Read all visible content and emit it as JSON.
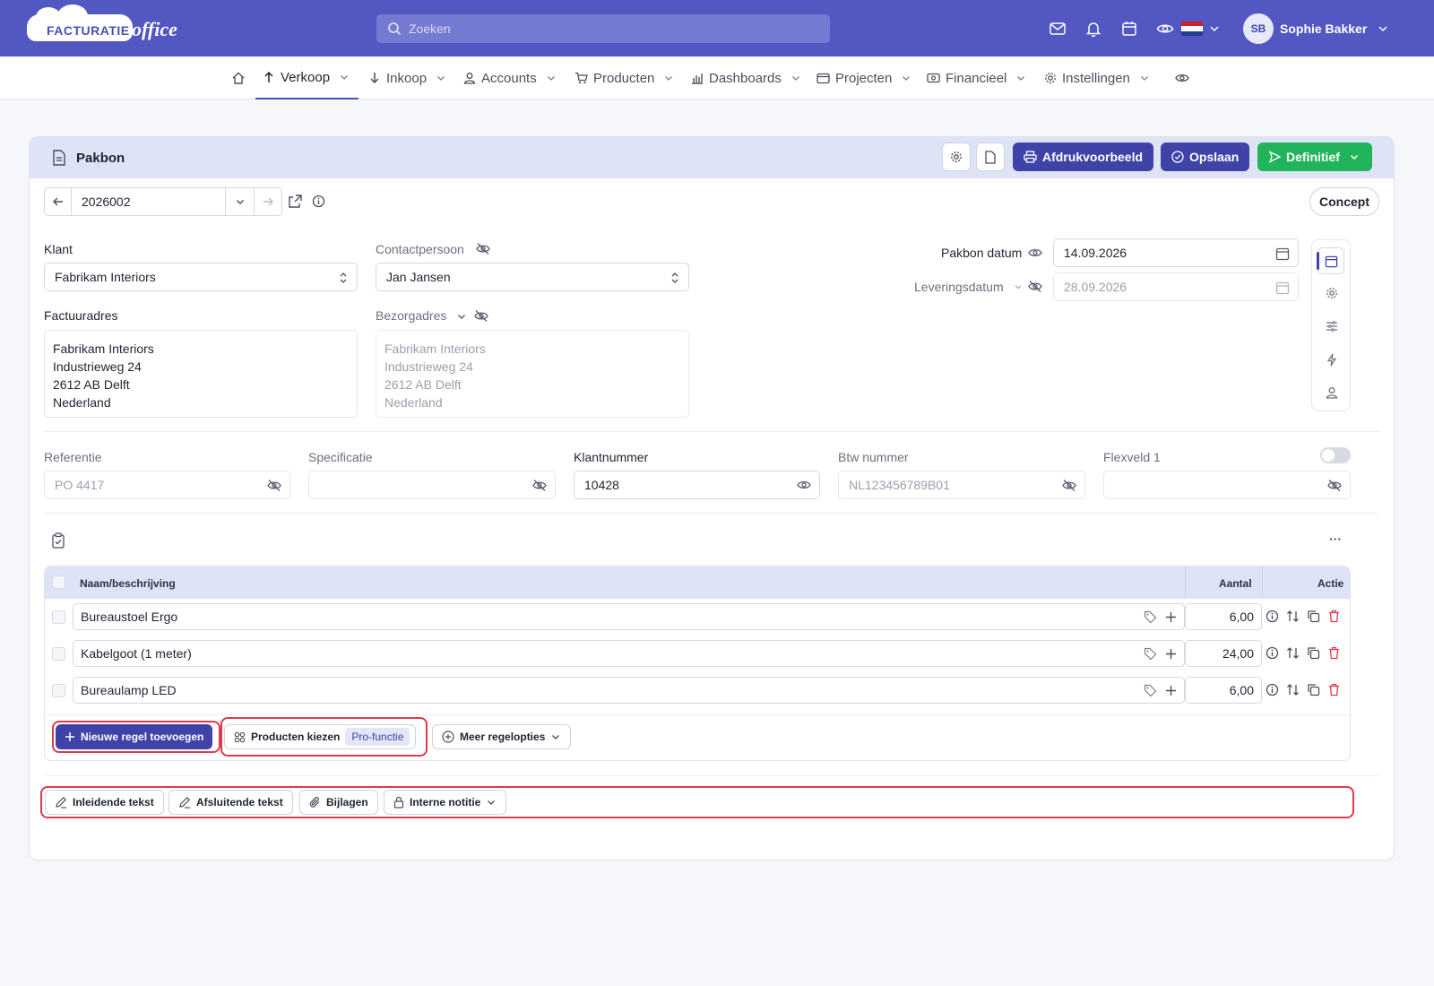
{
  "app": {
    "logo_text_1": "FACTURATIE",
    "logo_text_2": "office"
  },
  "search": {
    "placeholder": "Zoeken"
  },
  "user": {
    "initials": "SB",
    "name": "Sophie Bakker"
  },
  "nav": {
    "items": [
      {
        "label": "Verkoop"
      },
      {
        "label": "Inkoop"
      },
      {
        "label": "Accounts"
      },
      {
        "label": "Producten"
      },
      {
        "label": "Dashboards"
      },
      {
        "label": "Projecten"
      },
      {
        "label": "Financieel"
      },
      {
        "label": "Instellingen"
      }
    ]
  },
  "document": {
    "title": "Pakbon",
    "buttons": {
      "preview": "Afdrukvoorbeeld",
      "save": "Opslaan",
      "final": "Definitief"
    },
    "number": "2026002",
    "status": "Concept"
  },
  "form": {
    "klant_label": "Klant",
    "klant_value": "Fabrikam Interiors",
    "contact_label": "Contactpersoon",
    "contact_value": "Jan Jansen",
    "factuuradres_label": "Factuuradres",
    "factuuradres": [
      "Fabrikam Interiors",
      "Industrieweg 24",
      "2612 AB Delft",
      "Nederland"
    ],
    "bezorgadres_label": "Bezorgadres",
    "bezorgadres": [
      "Fabrikam Interiors",
      "Industrieweg 24",
      "2612 AB Delft",
      "Nederland"
    ],
    "pakbon_datum_label": "Pakbon datum",
    "pakbon_datum": "14.09.2026",
    "leveringsdatum_label": "Leveringsdatum",
    "leveringsdatum": "28.09.2026",
    "referentie_label": "Referentie",
    "referentie": "PO 4417",
    "specificatie_label": "Specificatie",
    "specificatie": "",
    "klantnummer_label": "Klantnummer",
    "klantnummer": "10428",
    "btw_label": "Btw nummer",
    "btw": "NL123456789B01",
    "flexveld_label": "Flexveld 1",
    "flexveld": ""
  },
  "table": {
    "headers": {
      "name": "Naam/beschrijving",
      "qty": "Aantal",
      "action": "Actie"
    },
    "rows": [
      {
        "name": "Bureaustoel Ergo",
        "qty": "6,00"
      },
      {
        "name": "Kabelgoot (1 meter)",
        "qty": "24,00"
      },
      {
        "name": "Bureaulamp LED",
        "qty": "6,00"
      }
    ],
    "buttons": {
      "add": "Nieuwe regel toevoegen",
      "choose": "Producten kiezen",
      "pro": "Pro-functie",
      "more": "Meer regelopties"
    },
    "more_dots": "···"
  },
  "footer": {
    "intro": "Inleidende tekst",
    "closing": "Afsluitende tekst",
    "attachments": "Bijlagen",
    "note": "Interne notitie"
  },
  "colors": {
    "primary": "#5257c2",
    "button_dark": "#3f43a8",
    "green": "#22b45a",
    "highlight": "#e0394b"
  }
}
